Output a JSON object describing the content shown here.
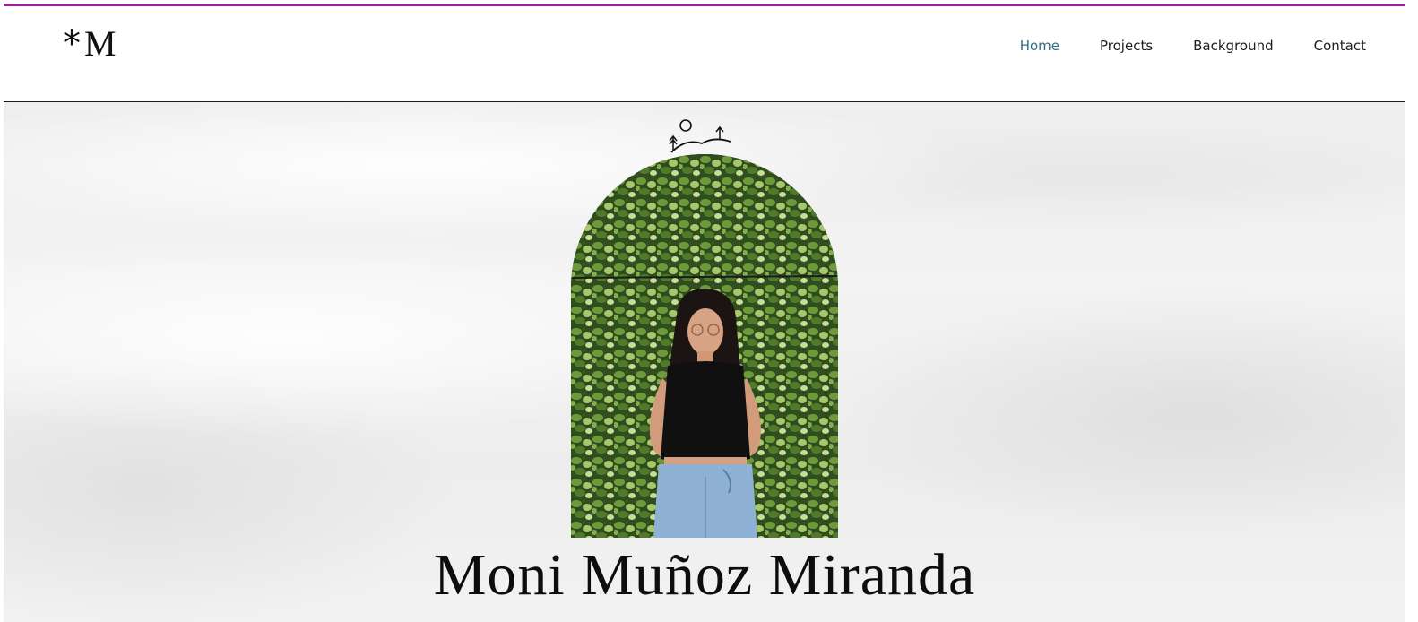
{
  "header": {
    "logo": {
      "star": "*",
      "letter": "M"
    },
    "nav": [
      {
        "label": "Home",
        "active": true
      },
      {
        "label": "Projects",
        "active": false
      },
      {
        "label": "Background",
        "active": false
      },
      {
        "label": "Contact",
        "active": false
      }
    ]
  },
  "hero": {
    "emblem_icon": "sun-mountains-icon",
    "photo": "portrait-photo",
    "name": "Moni Muñoz Miranda"
  },
  "colors": {
    "top_accent": "#9c1f9a",
    "nav_active": "#2f6f86",
    "text": "#111111"
  }
}
